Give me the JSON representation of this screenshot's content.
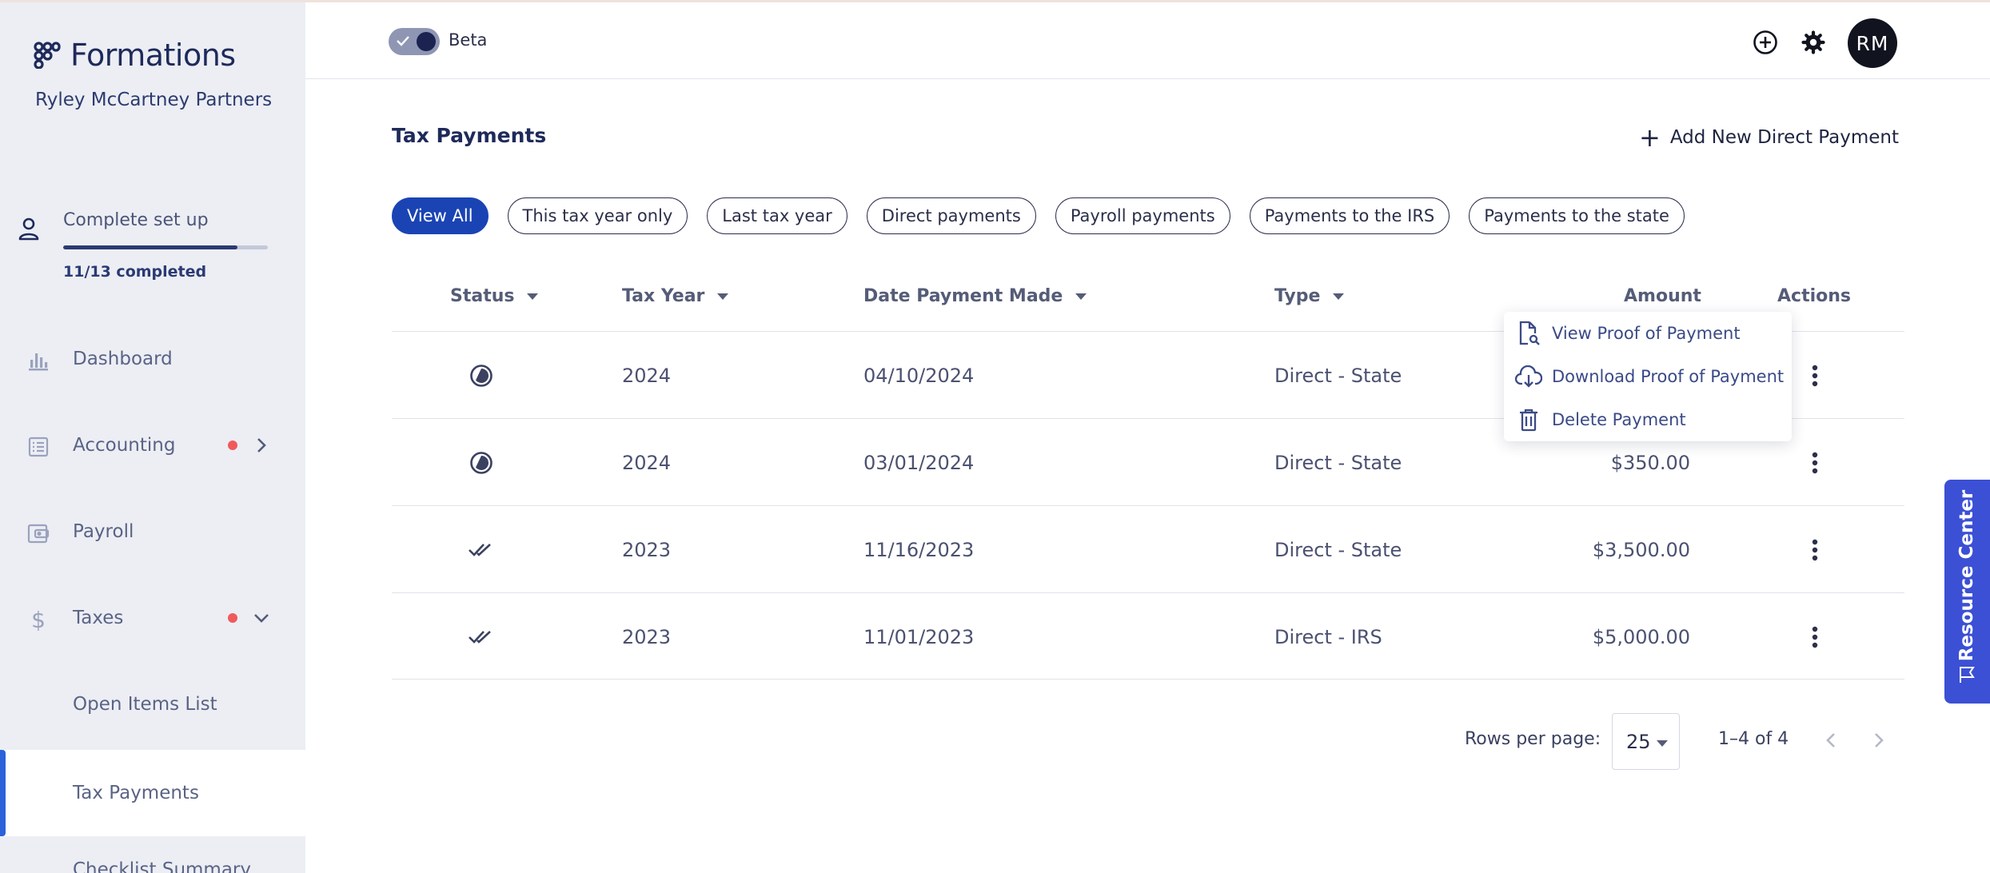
{
  "brand": {
    "name": "Formations",
    "company": "Ryley McCartney Partners"
  },
  "setup": {
    "label": "Complete set up",
    "count": "11/13 completed",
    "progress": 0.85
  },
  "sidebar": {
    "items": [
      {
        "label": "Dashboard",
        "icon": "bar-chart-icon"
      },
      {
        "label": "Accounting",
        "icon": "ledger-icon",
        "dot": true,
        "chevron": "right"
      },
      {
        "label": "Payroll",
        "icon": "wallet-icon"
      },
      {
        "label": "Taxes",
        "icon": "dollar-icon",
        "dot": true,
        "chevron": "down"
      },
      {
        "label": "Open Items List"
      },
      {
        "label": "Tax Payments",
        "active": true
      },
      {
        "label": "Checklist Summary"
      }
    ]
  },
  "header": {
    "beta_label": "Beta",
    "avatar_initials": "RM"
  },
  "page": {
    "title": "Tax Payments",
    "add_button": "Add New Direct Payment"
  },
  "filters": [
    "View All",
    "This tax year only",
    "Last tax year",
    "Direct payments",
    "Payroll payments",
    "Payments to the IRS",
    "Payments to the state"
  ],
  "table": {
    "columns": {
      "status": "Status",
      "tax_year": "Tax Year",
      "date": "Date Payment Made",
      "type": "Type",
      "amount": "Amount",
      "actions": "Actions"
    },
    "rows": [
      {
        "status": "pending",
        "tax_year": "2024",
        "date": "04/10/2024",
        "type": "Direct - State",
        "amount": ""
      },
      {
        "status": "pending",
        "tax_year": "2024",
        "date": "03/01/2024",
        "type": "Direct - State",
        "amount": "$350.00"
      },
      {
        "status": "completed",
        "tax_year": "2023",
        "date": "11/16/2023",
        "type": "Direct - State",
        "amount": "$3,500.00"
      },
      {
        "status": "completed",
        "tax_year": "2023",
        "date": "11/01/2023",
        "type": "Direct - IRS",
        "amount": "$5,000.00"
      }
    ]
  },
  "row_menu": {
    "items": [
      {
        "label": "View Proof of Payment",
        "icon": "file-view-icon"
      },
      {
        "label": "Download Proof of Payment",
        "icon": "cloud-download-icon"
      },
      {
        "label": "Delete Payment",
        "icon": "trash-icon"
      }
    ]
  },
  "pagination": {
    "rows_label": "Rows per page:",
    "rows_value": "25",
    "range": "1–4 of 4"
  },
  "resource_center": {
    "label": "Resource Center"
  },
  "colors": {
    "accent": "#1a44b4",
    "brand_navy": "#1e2a5a",
    "alert_dot": "#f05a5a",
    "resource_tab": "#3b50d4"
  }
}
